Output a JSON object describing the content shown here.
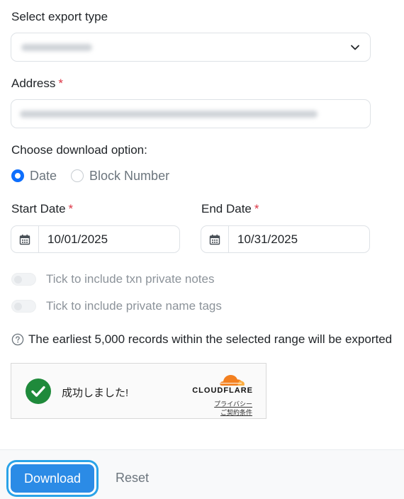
{
  "export_type": {
    "label": "Select export type",
    "value": "Transactions"
  },
  "address": {
    "label": "Address",
    "required_mark": "*",
    "value": ""
  },
  "download_option": {
    "label": "Choose download option:",
    "options": [
      {
        "label": "Date",
        "selected": true
      },
      {
        "label": "Block Number",
        "selected": false
      }
    ]
  },
  "start_date": {
    "label": "Start Date",
    "required_mark": "*",
    "value": "10/01/2025"
  },
  "end_date": {
    "label": "End Date",
    "required_mark": "*",
    "value": "10/31/2025"
  },
  "toggles": [
    {
      "label": "Tick to include txn private notes",
      "checked": false
    },
    {
      "label": "Tick to include private name tags",
      "checked": false
    }
  ],
  "info": {
    "text": "The earliest 5,000 records within the selected range will be exported"
  },
  "captcha": {
    "status_text": "成功しました!",
    "brand": "CLOUDFLARE",
    "privacy_link": "プライバシー",
    "terms_link": "ご契約条件"
  },
  "footer": {
    "download_label": "Download",
    "reset_label": "Reset"
  },
  "colors": {
    "primary": "#2b8be6",
    "focus_ring": "#2aa3e8",
    "required": "#dc3545",
    "success": "#1f8a3b",
    "cloudflare_orange": "#f38020"
  }
}
